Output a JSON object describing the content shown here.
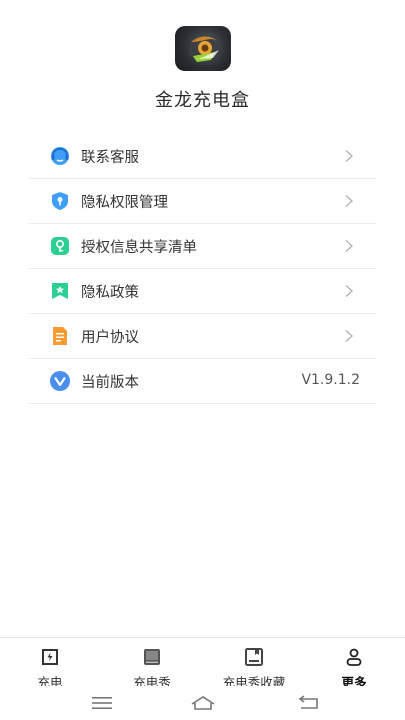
{
  "app": {
    "name": "金龙充电盒",
    "icon": "dragon-app-icon"
  },
  "menu": {
    "items": [
      {
        "label": "联系客服",
        "icon": "customer-service-icon",
        "color": "#3f9ef5"
      },
      {
        "label": "隐私权限管理",
        "icon": "privacy-shield-icon",
        "color": "#3f9ef5"
      },
      {
        "label": "授权信息共享清单",
        "icon": "authorization-icon",
        "color": "#2ccf92"
      },
      {
        "label": "隐私政策",
        "icon": "policy-bookmark-icon",
        "color": "#2ccf92"
      },
      {
        "label": "用户协议",
        "icon": "agreement-doc-icon",
        "color": "#f6992f"
      },
      {
        "label": "当前版本",
        "icon": "version-v-icon",
        "color": "#4a8ff0",
        "value": "V1.9.1.2"
      }
    ]
  },
  "tabbar": {
    "tabs": [
      {
        "label": "充电",
        "icon": "charge-icon"
      },
      {
        "label": "充电秀",
        "icon": "charge-show-icon"
      },
      {
        "label": "充电秀收藏",
        "icon": "favorites-icon"
      },
      {
        "label": "更多",
        "icon": "more-user-icon",
        "active": true
      }
    ]
  },
  "navbar": {
    "buttons": [
      "menu-icon",
      "home-icon",
      "back-icon"
    ]
  }
}
